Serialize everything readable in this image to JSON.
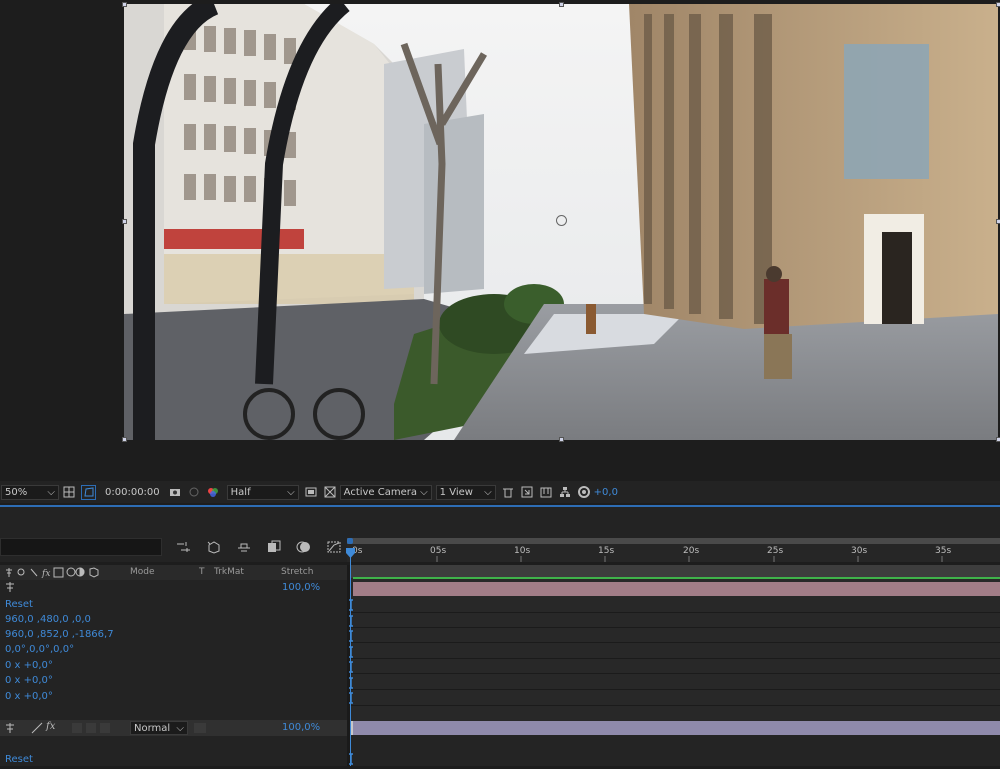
{
  "viewer_toolbar": {
    "zoom": "50%",
    "timecode": "0:00:00:00",
    "resolution": "Half",
    "camera": "Active Camera",
    "views": "1 View",
    "exposure": "+0,0"
  },
  "timeline": {
    "ruler_labels": [
      "0s",
      "05s",
      "10s",
      "15s",
      "20s",
      "25s",
      "30s",
      "35s"
    ],
    "columns": {
      "mode": "Mode",
      "t": "T",
      "trkmat": "TrkMat",
      "stretch": "Stretch"
    },
    "layer1": {
      "stretch": "100,0%",
      "reset": "Reset",
      "props": [
        "960,0 ,480,0 ,0,0",
        "960,0 ,852,0 ,-1866,7",
        "0,0°,0,0°,0,0°",
        "0 x +0,0°",
        "0 x +0,0°",
        "0 x +0,0°"
      ]
    },
    "layer2": {
      "mode": "Normal",
      "stretch": "100,0%",
      "reset": "Reset"
    }
  },
  "colors": {
    "accent": "#2d6db5",
    "value_blue": "#3f8ad8",
    "layer1_bar": "#a27d87",
    "layer2_bar": "#8f8aab",
    "work_area_green": "#3fb34a"
  }
}
